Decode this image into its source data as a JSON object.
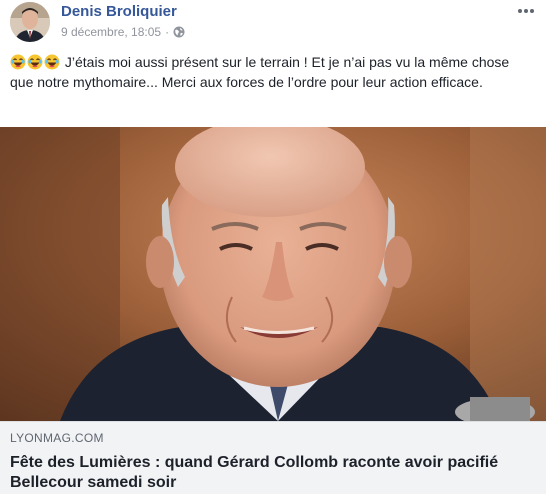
{
  "post": {
    "author": "Denis Broliquier",
    "date": "9 décembre, 18:05",
    "meta_separator": "·",
    "privacy_icon": "globe-icon",
    "more_icon": "more-options-icon",
    "emojis": [
      "laughing-emoji",
      "laughing-emoji",
      "laughing-emoji"
    ],
    "text": "J’étais moi aussi présent sur le terrain ! Et je n’ai pas vu la même chose que notre mythomaire... Merci aux forces de l’ordre pour leur action efficace."
  },
  "link": {
    "domain": "LYONMAG.COM",
    "title": "Fête des Lumières : quand Gérard Collomb raconte avoir pacifié Bellecour samedi soir"
  },
  "colors": {
    "author": "#365899",
    "meta": "#90949c",
    "link_bg": "#f2f3f5"
  }
}
